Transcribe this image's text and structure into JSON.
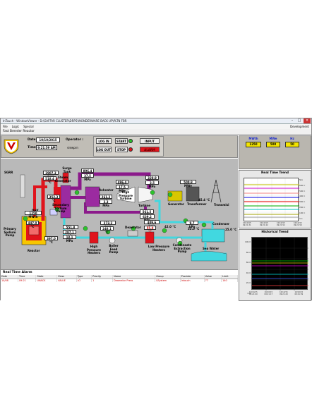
{
  "window": {
    "title": "InTouch - WindowViewer - D:\\GAFFAR CLUSTER\\DRPS\\WONDERWARE BACK UP\\PLTN FBR",
    "menu": [
      "File",
      "Logic",
      "Special"
    ],
    "menu_right": "Development"
  },
  "app_title": "Fast Breeder Reactor",
  "header": {
    "date_label": "Date :",
    "date_value": "10/10/2015",
    "time_label": "Time :",
    "time_value": "9:21:59 AM",
    "operator_label": "Operator :",
    "operator_value": "viewprn"
  },
  "controls": {
    "log_in": "LOG IN",
    "log_out": "LOG OUT",
    "start": "START",
    "stop": "STOP",
    "input": "INPUT",
    "alarm": "ALARM"
  },
  "gauges": {
    "mwth": {
      "label": "MWth",
      "value": "1250"
    },
    "mwe": {
      "label": "MWe",
      "value": "500"
    },
    "hz": {
      "label": "Hz",
      "value": "50"
    }
  },
  "colors": {
    "accent_red": "#e0141c",
    "pipe_purple": "#8b1a8b",
    "pipe_cyan": "#41d8e0",
    "value_yellow": "#f2e300"
  },
  "plant": {
    "sgrr_label": "SGRR",
    "surge_tank": "Surge Tank",
    "val_2907": "2907.3 kg/s",
    "val_518": "518.4 °C",
    "steam_gen": "Steam Generator",
    "val_896": "896.4 °C",
    "val_375": "37.5 MPa",
    "reheater": "Reheater",
    "val_2612": "261.2 °C",
    "val_33": "3.3 MPa",
    "val_4964": "496.4 °C",
    "val_175": "17.5 MPa",
    "hp_turbine": "High Pressure Turbine",
    "turbine": "Turbine",
    "val_3289": "328.9 °C",
    "val_35": "3.5 MPa",
    "val_5615": "561.5 °C",
    "val_6392": "639.2 MPa",
    "generator": "Generator",
    "val_5008": "500.8 MWe",
    "transformer": "Transformer",
    "transmission": "Transmisi",
    "dhx": "DHX",
    "val_3523": "352.3 °C",
    "secondary_pump": "Secondary Sodium Pump",
    "val_1250": "1250 MWth",
    "val_4470": "447.0 °C",
    "val_3970": "397.0 °C",
    "primary_pump": "Primary Sodium Pump",
    "reactor": "Reactor",
    "val_5518": "551.8 kg/s",
    "val_2871": "287.1 °C",
    "val_181": "18.1 MPa",
    "hp_heaters": "High Pressure Heaters",
    "val_2732": "273.2 kg/s",
    "val_2481": "248.1 °C",
    "bfp": "Boiler Feed Pump",
    "deaerator": "Deaerator",
    "val_4096": "409.6 kg/s",
    "val_550": "55.0 °C",
    "lp_heaters": "Low Pressure Heaters",
    "val_420": "42.0 °C",
    "cond_pump": "Condensate Extraction Pump",
    "val_97": "9.7 kPa",
    "val_330": "33.0 °C",
    "condenser": "Condenser",
    "val_454": "45.4 °C",
    "val_250": "25.0 °C",
    "sea_water": "Sea Water"
  },
  "trend": {
    "rt_title": "Real Time Trend",
    "rt_scale": [
      "N/A",
      "600 C",
      "500 C",
      "400 C",
      "300 C",
      "200 C",
      "100 C",
      "0 C"
    ],
    "rt_times": [
      "10/10/15 09:21:31",
      "10/10/15 09:21:42",
      "10/10/15 09:21:52",
      "10/10/15 09:21:59"
    ],
    "hist_title": "Historical Trend",
    "hist_scale": [
      "100.0",
      "80.0",
      "60.0",
      "40.0",
      "20.0",
      "0.0"
    ],
    "hist_times": [
      "10/10/15 09:21:09",
      "10/10/15 09:21:17",
      "10/10/15 09:21:29",
      "10/10/15 09:21:39"
    ]
  },
  "alarm": {
    "title": "Real Time Alarm",
    "columns": [
      "Date",
      "Time",
      "State",
      "Class",
      "Type",
      "Priority",
      "Name",
      "Group",
      "Provider",
      "Value",
      "Limit"
    ],
    "rows": [
      [
        "10/08",
        "09:21",
        "UNACK",
        "VALUE",
        "LO",
        "1",
        "1",
        "Deaerator Press",
        "$System",
        "Intouch",
        "77",
        "140"
      ]
    ]
  }
}
